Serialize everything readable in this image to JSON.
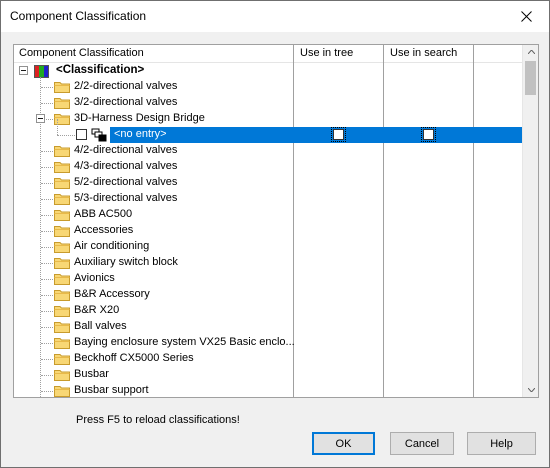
{
  "window": {
    "title": "Component Classification"
  },
  "columns": [
    "Component Classification",
    "Use in tree",
    "Use in search"
  ],
  "tree": {
    "root_label": "<Classification>",
    "items": [
      "2/2-directional valves",
      "3/2-directional valves",
      "3D-Harness Design Bridge",
      "4/2-directional valves",
      "4/3-directional valves",
      "5/2-directional valves",
      "5/3-directional valves",
      "ABB AC500",
      "Accessories",
      "Air conditioning",
      "Auxiliary switch block",
      "Avionics",
      "B&R Accessory",
      "B&R X20",
      "Ball valves",
      "Baying enclosure system VX25 Basic enclo...",
      "Beckhoff CX5000 Series",
      "Busbar",
      "Busbar support"
    ],
    "child_label": "<no entry>"
  },
  "status_text": "Press F5 to reload classifications!",
  "buttons": {
    "ok": "OK",
    "cancel": "Cancel",
    "help": "Help"
  },
  "colors": {
    "selection": "#0078d7",
    "folder": "#f5d06b"
  }
}
